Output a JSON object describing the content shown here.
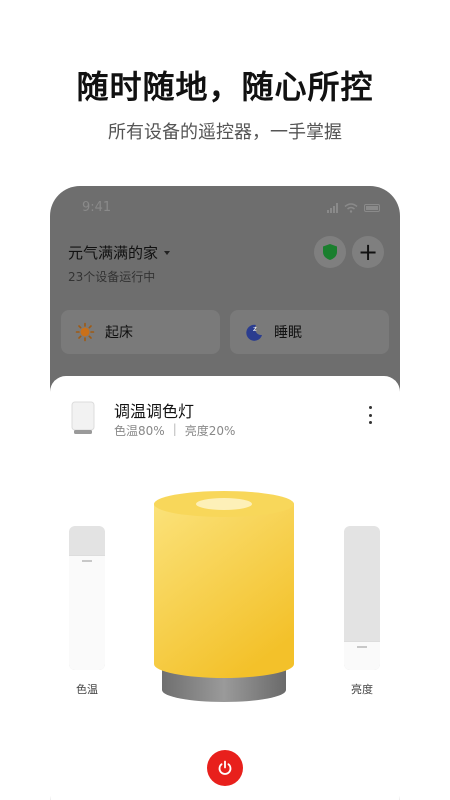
{
  "promo": {
    "headline": "随时随地，随心所控",
    "subline": "所有设备的遥控器，一手掌握"
  },
  "status_bar": {
    "time": "9:41"
  },
  "home": {
    "title": "元气满满的家",
    "subtitle": "23个设备运行中"
  },
  "header_actions": {
    "add_label": "+"
  },
  "scenes": [
    {
      "label": "起床",
      "icon": "sun-icon"
    },
    {
      "label": "睡眠",
      "icon": "moon-sleep-icon"
    }
  ],
  "device": {
    "name": "调温调色灯",
    "color_temp_text": "色温80%",
    "separator": "|",
    "brightness_text": "亮度20%",
    "color_temp_level": 0.8,
    "brightness_level": 0.2
  },
  "sliders": {
    "temp_label": "色温",
    "brightness_label": "亮度"
  },
  "colors": {
    "lamp_yellow": "#f7cb2f",
    "power_red": "#e8201c",
    "shield_green": "#1a7f2e"
  }
}
